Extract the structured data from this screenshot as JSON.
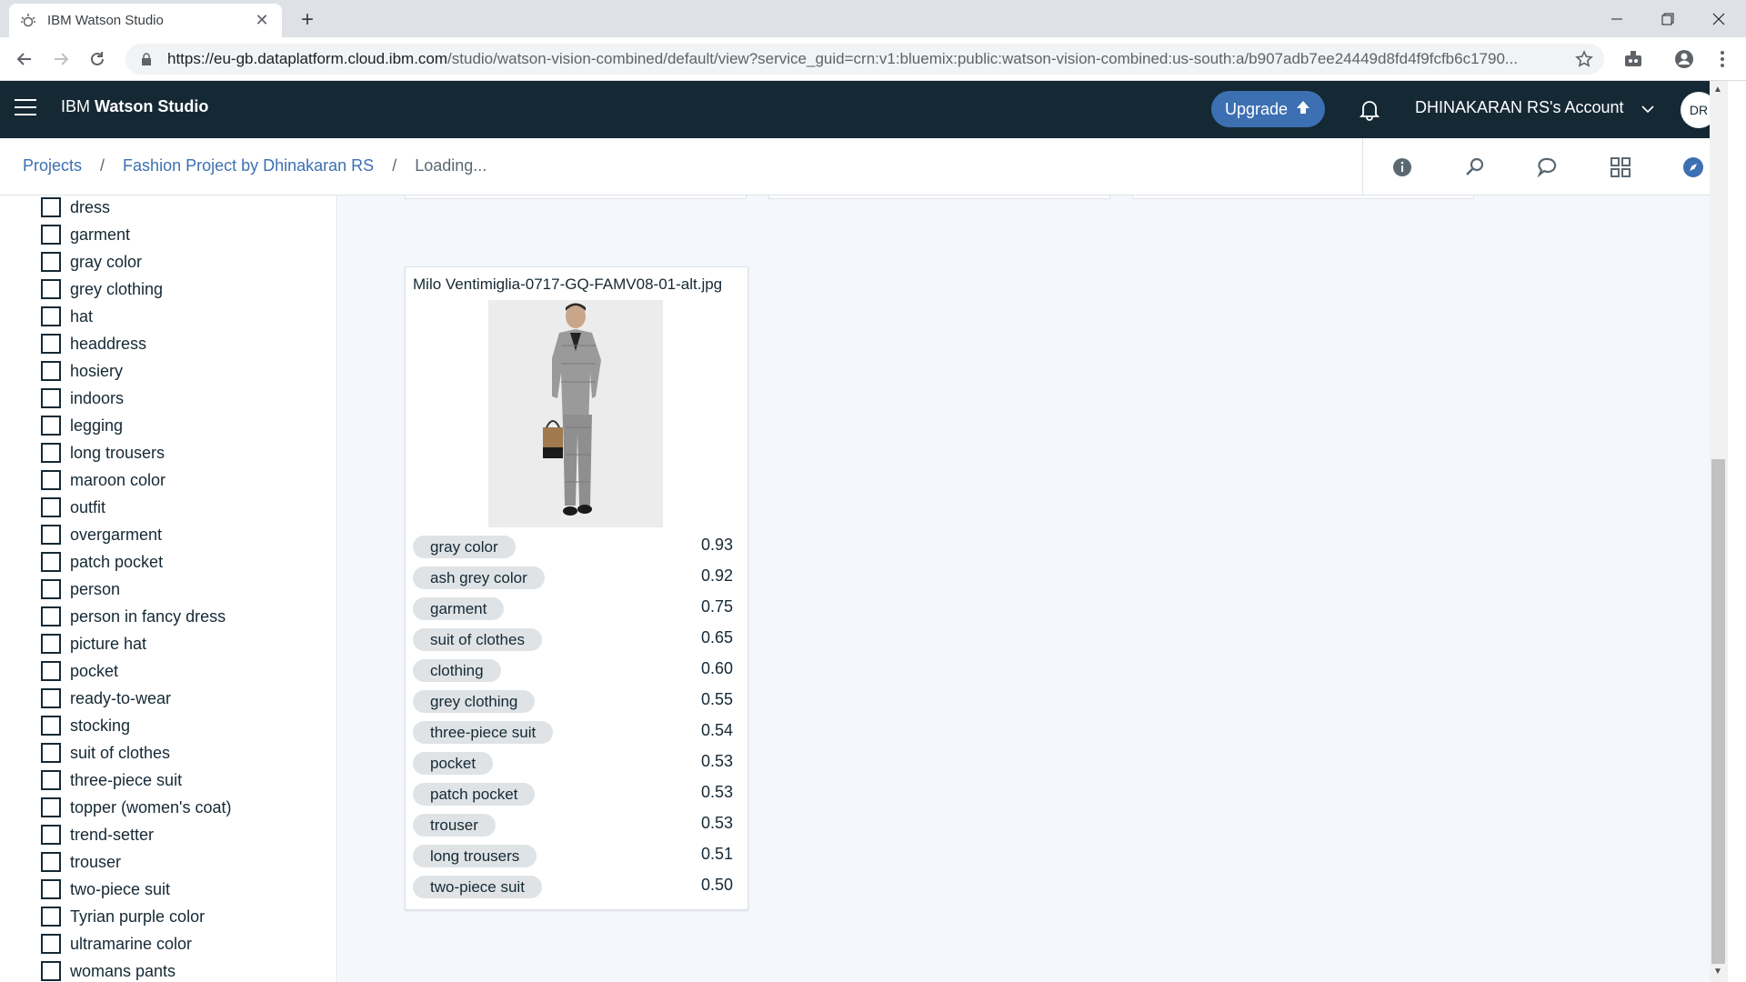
{
  "browser": {
    "tab_title": "IBM Watson Studio",
    "url_host": "https://eu-gb.dataplatform.cloud.ibm.com",
    "url_path": "/studio/watson-vision-combined/default/view?service_guid=crn:v1:bluemix:public:watson-vision-combined:us-south:a/b907adb7ee24449d8fd4f9fcfb6c1790..."
  },
  "header": {
    "brand_prefix": "IBM ",
    "brand_name": "Watson Studio",
    "upgrade_label": "Upgrade",
    "account_label": "DHINAKARAN RS's Account",
    "avatar_initials": "DR"
  },
  "breadcrumb": {
    "projects": "Projects",
    "project": "Fashion Project by Dhinakaran RS",
    "current": "Loading...",
    "separator": "/"
  },
  "sidebar": {
    "filters": [
      "dress",
      "garment",
      "gray color",
      "grey clothing",
      "hat",
      "headdress",
      "hosiery",
      "indoors",
      "legging",
      "long trousers",
      "maroon color",
      "outfit",
      "overgarment",
      "patch pocket",
      "person",
      "person in fancy dress",
      "picture hat",
      "pocket",
      "ready-to-wear",
      "stocking",
      "suit of clothes",
      "three-piece suit",
      "topper (women's coat)",
      "trend-setter",
      "trouser",
      "two-piece suit",
      "Tyrian purple color",
      "ultramarine color",
      "womans pants"
    ]
  },
  "result_card": {
    "filename": "Milo Ventimiglia-0717-GQ-FAMV08-01-alt.jpg",
    "tags": [
      {
        "label": "gray color",
        "score": "0.93"
      },
      {
        "label": "ash grey color",
        "score": "0.92"
      },
      {
        "label": "garment",
        "score": "0.75"
      },
      {
        "label": "suit of clothes",
        "score": "0.65"
      },
      {
        "label": "clothing",
        "score": "0.60"
      },
      {
        "label": "grey clothing",
        "score": "0.55"
      },
      {
        "label": "three-piece suit",
        "score": "0.54"
      },
      {
        "label": "pocket",
        "score": "0.53"
      },
      {
        "label": "patch pocket",
        "score": "0.53"
      },
      {
        "label": "trouser",
        "score": "0.53"
      },
      {
        "label": "long trousers",
        "score": "0.51"
      },
      {
        "label": "two-piece suit",
        "score": "0.50"
      }
    ]
  },
  "colors": {
    "header_bg": "#152935",
    "accent": "#3d70b2",
    "main_bg": "#f4f7fb",
    "tag_bg": "#dfe3e6"
  }
}
